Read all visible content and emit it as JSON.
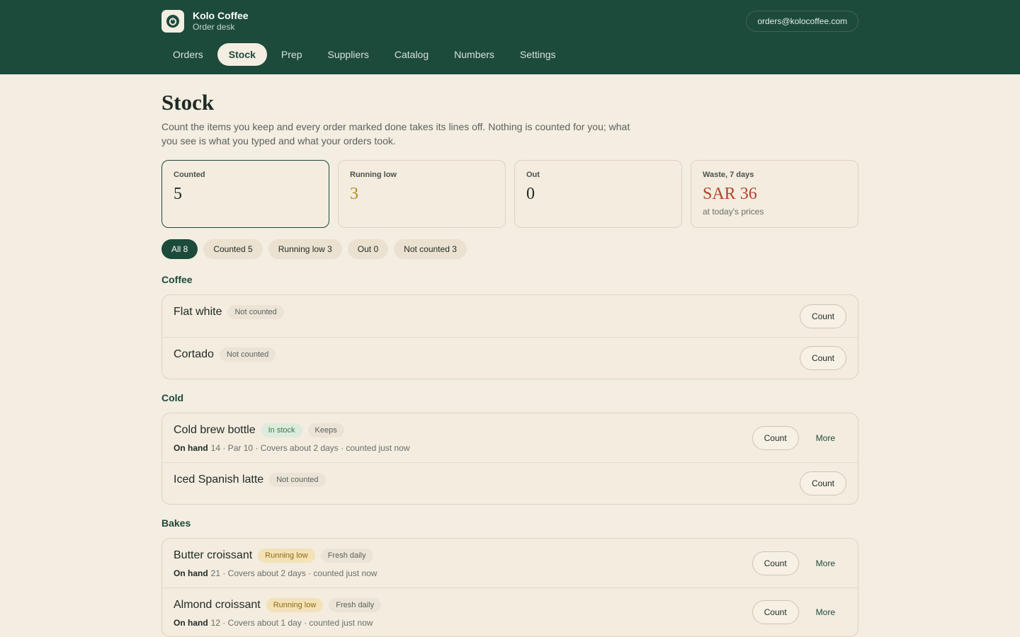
{
  "app": {
    "name": "Kolo Coffee",
    "subtitle": "Order desk",
    "email": "orders@kolocoffee.com",
    "logo_icon": "power-ring-icon"
  },
  "colors": {
    "brand": "#1c4a3b",
    "background": "#f4ede1",
    "warning": "#b58a1d",
    "danger": "#b3432f"
  },
  "nav": {
    "tabs": [
      {
        "label": "Orders",
        "active": false
      },
      {
        "label": "Stock",
        "active": true
      },
      {
        "label": "Prep",
        "active": false
      },
      {
        "label": "Suppliers",
        "active": false
      },
      {
        "label": "Catalog",
        "active": false
      },
      {
        "label": "Numbers",
        "active": false
      },
      {
        "label": "Settings",
        "active": false
      }
    ]
  },
  "page": {
    "title": "Stock",
    "intro": "Count the items you keep and every order marked done takes its lines off. Nothing is counted for you; what you see is what you typed and what your orders took."
  },
  "stats": [
    {
      "label": "Counted",
      "value": "5",
      "note": ""
    },
    {
      "label": "Running low",
      "value": "3",
      "note": ""
    },
    {
      "label": "Out",
      "value": "0",
      "note": ""
    },
    {
      "label": "Waste, 7 days",
      "value": "SAR 36",
      "note": "at today's prices"
    }
  ],
  "filters": [
    {
      "label": "All 8",
      "active": true
    },
    {
      "label": "Counted 5",
      "active": false
    },
    {
      "label": "Running low 3",
      "active": false
    },
    {
      "label": "Out 0",
      "active": false
    },
    {
      "label": "Not counted 3",
      "active": false
    }
  ],
  "labels": {
    "on_hand": "On hand",
    "count": "Count",
    "more": "More"
  },
  "groups": [
    {
      "name": "Coffee",
      "items": [
        {
          "name": "Flat white",
          "badges": [
            "Not counted"
          ],
          "meta": ""
        },
        {
          "name": "Cortado",
          "badges": [
            "Not counted"
          ],
          "meta": ""
        }
      ]
    },
    {
      "name": "Cold",
      "items": [
        {
          "name": "Cold brew bottle",
          "badges": [
            "In stock",
            "Keeps"
          ],
          "meta": "14 · Par 10 · Covers about 2 days · counted just now"
        },
        {
          "name": "Iced Spanish latte",
          "badges": [
            "Not counted"
          ],
          "meta": ""
        }
      ]
    },
    {
      "name": "Bakes",
      "items": [
        {
          "name": "Butter croissant",
          "badges": [
            "Running low",
            "Fresh daily"
          ],
          "meta": "21 · Covers about 2 days · counted just now"
        },
        {
          "name": "Almond croissant",
          "badges": [
            "Running low",
            "Fresh daily"
          ],
          "meta": "12 · Covers about 1 day · counted just now"
        }
      ]
    }
  ]
}
